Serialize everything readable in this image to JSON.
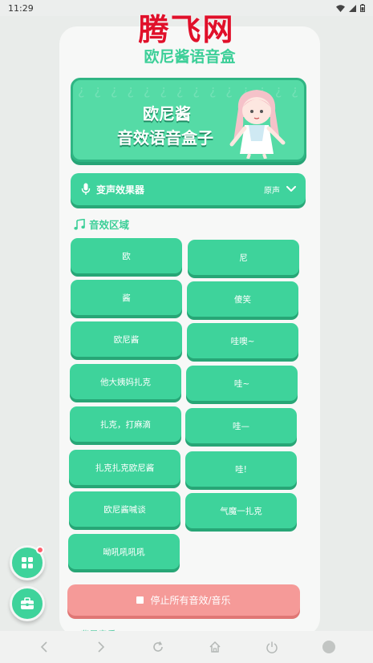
{
  "status_bar": {
    "time": "11:29"
  },
  "watermark": "腾飞网",
  "app": {
    "title": "欧尼酱语音盒"
  },
  "banner": {
    "line1": "欧尼酱",
    "line2": "音效语音盒子",
    "pattern": "¿¿¿¿¿¿¿¿¿¿¿¿¿¿¿¿¿¿¿¿¿¿¿¿¿¿¿¿¿¿¿¿¿¿¿¿¿¿¿¿"
  },
  "voice_changer": {
    "label": "变声效果器",
    "value": "原声"
  },
  "sound_section": {
    "title": "音效区域"
  },
  "sounds": [
    "欧",
    "尼",
    "酱",
    "傻笑",
    "欧尼酱",
    "哇噢~",
    "他大姨妈扎克",
    "哇~",
    "扎克，打麻滴",
    "哇—",
    "扎克扎克欧尼酱",
    "哇!",
    "欧尼酱喊谈",
    "气魔一扎克",
    "呦吼吼吼吼"
  ],
  "stop_button": {
    "label": "停止所有音效/音乐"
  },
  "next_section": {
    "title": "♪ 背景音乐"
  },
  "colors": {
    "accent": "#3ed39b",
    "accent_dark": "#27a676",
    "stop": "#f59a98",
    "watermark": "#e0102a"
  }
}
